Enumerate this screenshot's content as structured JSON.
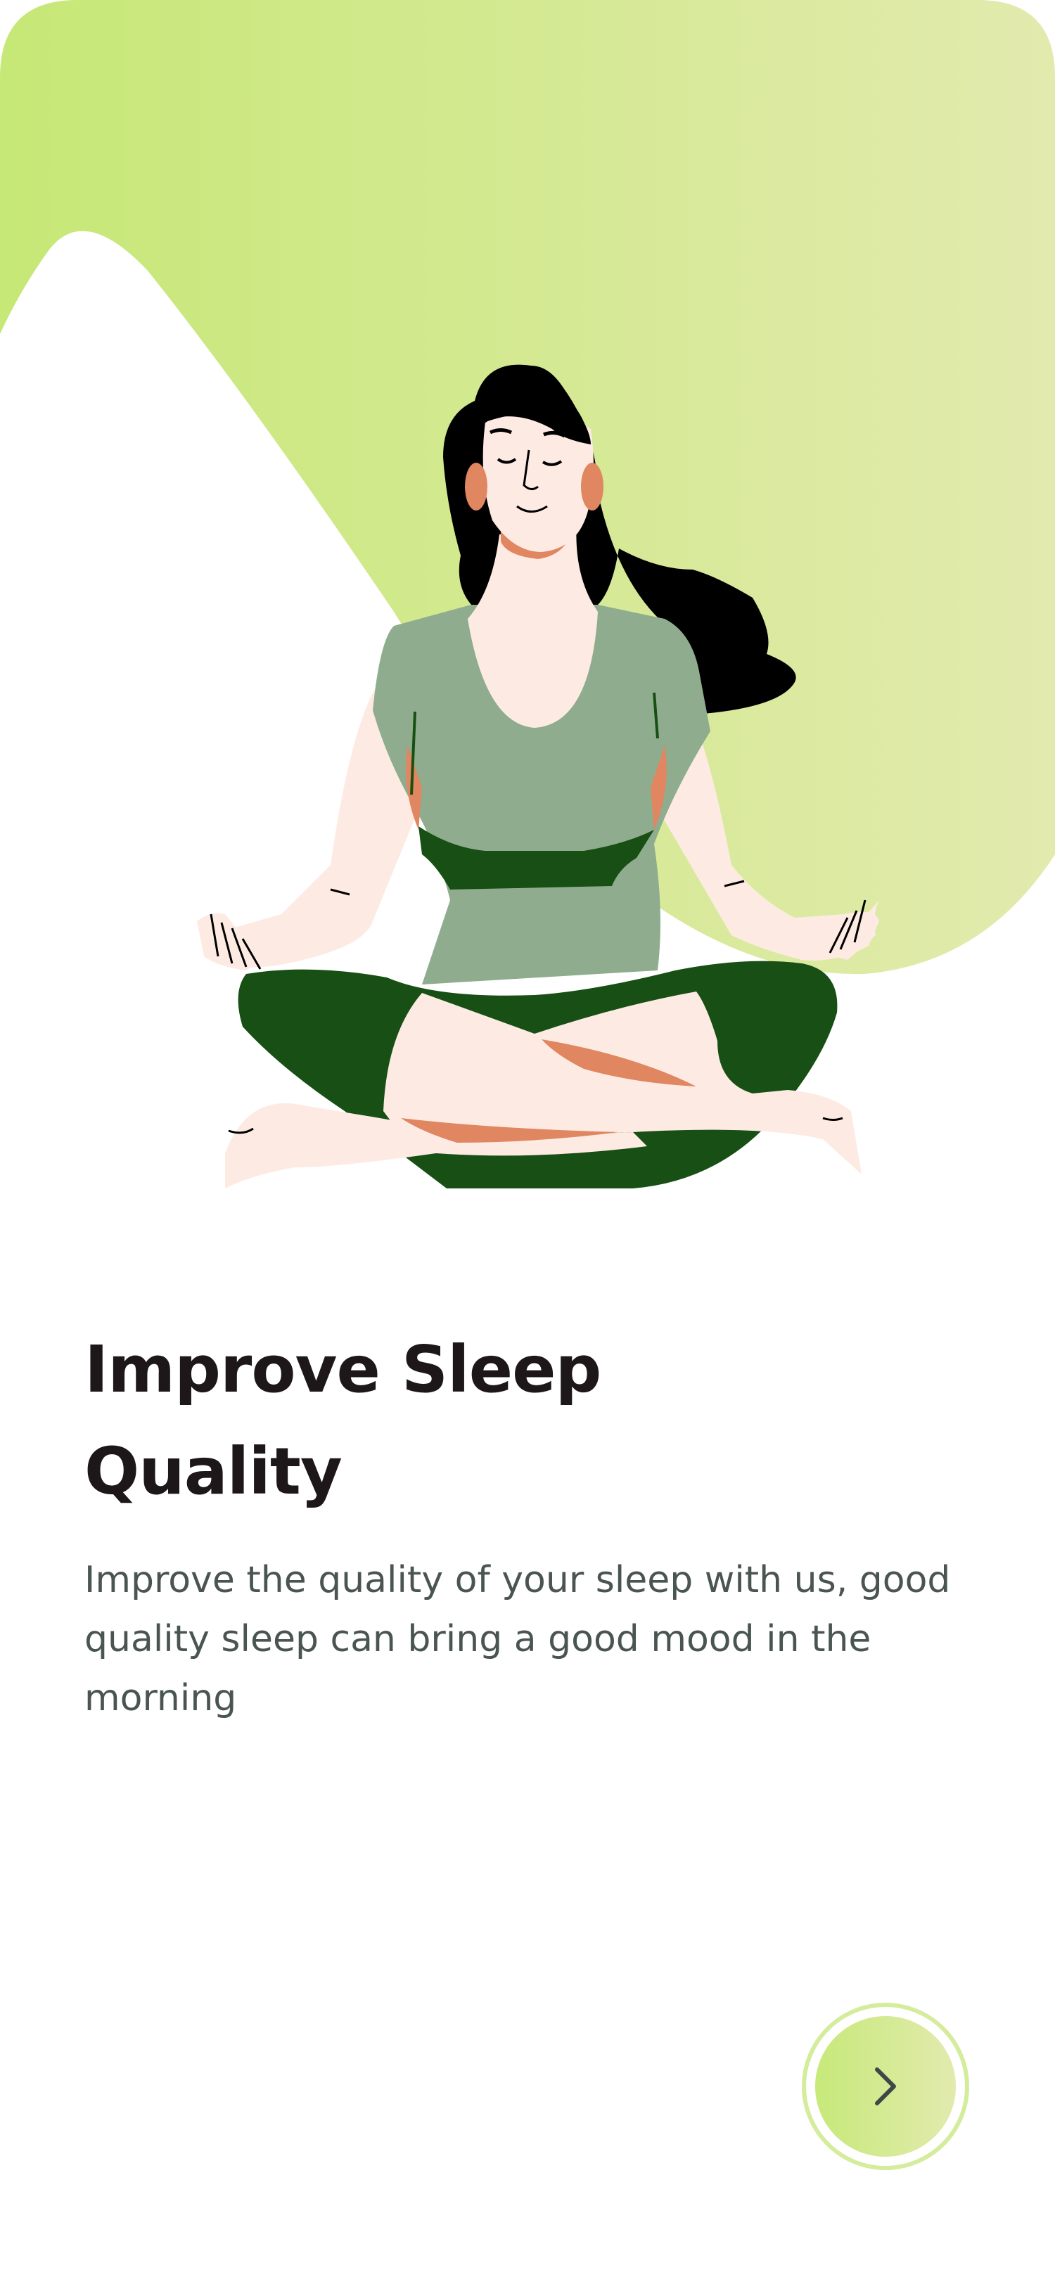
{
  "onboarding": {
    "title": "Improve Sleep Quality",
    "description": "Improve the quality of your sleep with us, good quality sleep can bring a good mood in the morning",
    "illustration": "woman-meditating",
    "next_icon": "chevron-right-icon"
  },
  "colors": {
    "background": "#ffffff",
    "accent_start": "#c7e97a",
    "accent_end": "#e2eaae",
    "title": "#1e1719",
    "body_text": "#4a5552",
    "shirt": "#8fad8e",
    "pants": "#174f14",
    "skin": "#fdebe3",
    "skin_shadow": "#e08660",
    "hair": "#000000"
  }
}
